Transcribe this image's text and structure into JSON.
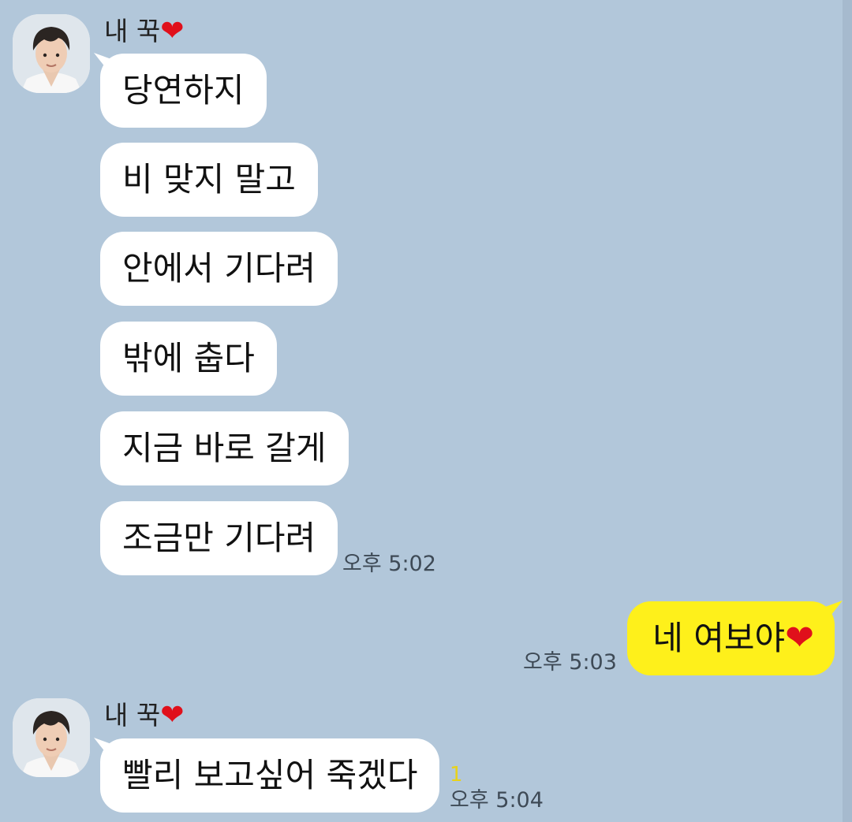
{
  "chat": {
    "messages": [
      {
        "sender": "내 꾹",
        "sender_heart": "❤",
        "bubbles": [
          "당연하지",
          "비 맞지 말고",
          "안에서 기다려",
          "밖에 춥다",
          "지금 바로 갈게",
          "조금만 기다려"
        ],
        "time": "오후 5:02"
      },
      {
        "sender": "me",
        "text": "네 여보야",
        "heart": "❤",
        "time": "오후 5:03"
      },
      {
        "sender": "내 꾹",
        "sender_heart": "❤",
        "bubbles": [
          "빨리 보고싶어 죽겠다"
        ],
        "unread_count": "1",
        "time": "오후 5:04"
      }
    ]
  },
  "icons": {
    "avatar": "profile-photo-icon",
    "heart": "red-heart-emoji"
  },
  "colors": {
    "background": "#b2c7da",
    "incoming_bubble": "#ffffff",
    "outgoing_bubble": "#fef01b",
    "unread": "#e8d21a",
    "heart": "#e0101b"
  }
}
